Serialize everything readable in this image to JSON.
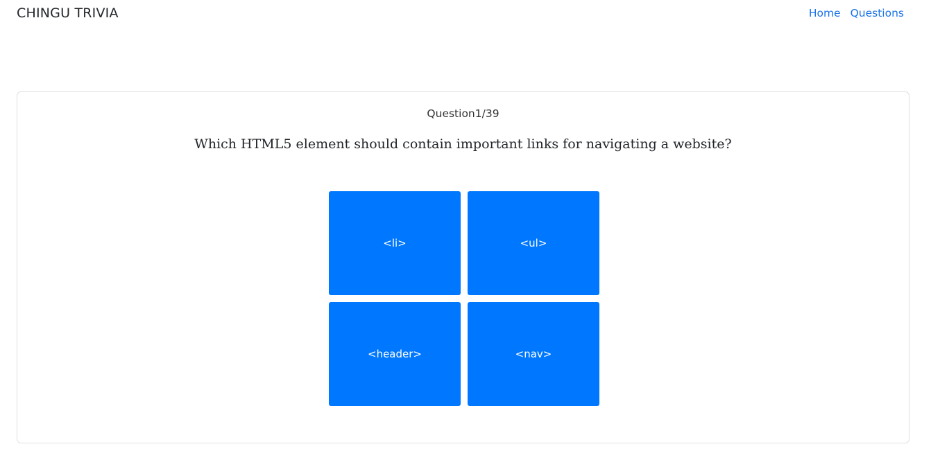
{
  "navbar": {
    "brand": "CHINGU TRIVIA",
    "links": [
      {
        "label": "Home"
      },
      {
        "label": "Questions"
      }
    ],
    "link_color": "#1a73e8"
  },
  "quiz": {
    "counter": "Question1/39",
    "question": "Which HTML5 element should contain important links for navigating a website?",
    "answers": [
      {
        "label": "<li>"
      },
      {
        "label": "<ul>"
      },
      {
        "label": "<header>"
      },
      {
        "label": "<nav>"
      }
    ],
    "answer_color": "#0077ff"
  }
}
